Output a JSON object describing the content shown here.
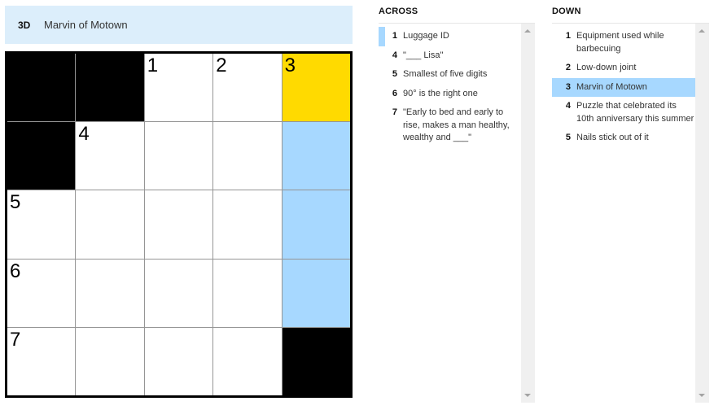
{
  "current_clue": {
    "number": "3D",
    "text": "Marvin of Motown"
  },
  "grid": {
    "rows": [
      [
        {
          "type": "block"
        },
        {
          "type": "block"
        },
        {
          "type": "open",
          "label": "1"
        },
        {
          "type": "open",
          "label": "2"
        },
        {
          "type": "selected",
          "label": "3"
        }
      ],
      [
        {
          "type": "block"
        },
        {
          "type": "open",
          "label": "4"
        },
        {
          "type": "open"
        },
        {
          "type": "open"
        },
        {
          "type": "word"
        }
      ],
      [
        {
          "type": "open",
          "label": "5"
        },
        {
          "type": "open"
        },
        {
          "type": "open"
        },
        {
          "type": "open"
        },
        {
          "type": "word"
        }
      ],
      [
        {
          "type": "open",
          "label": "6"
        },
        {
          "type": "open"
        },
        {
          "type": "open"
        },
        {
          "type": "open"
        },
        {
          "type": "word"
        }
      ],
      [
        {
          "type": "open",
          "label": "7"
        },
        {
          "type": "open"
        },
        {
          "type": "open"
        },
        {
          "type": "open"
        },
        {
          "type": "block"
        }
      ]
    ]
  },
  "across": {
    "title": "ACROSS",
    "clues": [
      {
        "num": "1",
        "text": "Luggage ID",
        "state": "cross"
      },
      {
        "num": "4",
        "text": "\"___ Lisa\"",
        "state": ""
      },
      {
        "num": "5",
        "text": "Smallest of five digits",
        "state": ""
      },
      {
        "num": "6",
        "text": "90° is the right one",
        "state": ""
      },
      {
        "num": "7",
        "text": "\"Early to bed and early to rise, makes a man healthy, wealthy and ___\"",
        "state": ""
      }
    ]
  },
  "down": {
    "title": "DOWN",
    "clues": [
      {
        "num": "1",
        "text": "Equipment used while barbecuing",
        "state": ""
      },
      {
        "num": "2",
        "text": "Low-down joint",
        "state": ""
      },
      {
        "num": "3",
        "text": "Marvin of Motown",
        "state": "hl"
      },
      {
        "num": "4",
        "text": "Puzzle that celebrated its 10th anniversary this summer",
        "state": ""
      },
      {
        "num": "5",
        "text": "Nails stick out of it",
        "state": ""
      }
    ]
  },
  "colors": {
    "selected": "#ffda00",
    "word": "#a7d8ff",
    "clue_bar": "#dceefb"
  }
}
